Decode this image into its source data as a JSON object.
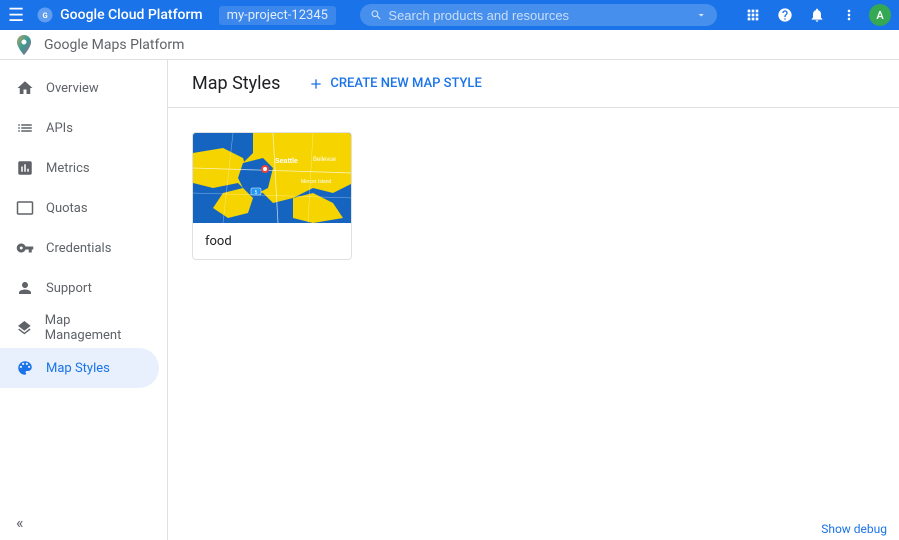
{
  "header": {
    "menu_label": "☰",
    "title": "Google Cloud Platform",
    "project_id": "my-project-12345",
    "search_placeholder": "Search products and resources",
    "icons": {
      "grid": "⊞",
      "help": "?",
      "bell": "🔔",
      "more": "⋮"
    },
    "avatar_initials": "A"
  },
  "brand_bar": {
    "name": "Google Maps Platform"
  },
  "sidebar": {
    "items": [
      {
        "id": "overview",
        "label": "Overview",
        "icon": "home"
      },
      {
        "id": "apis",
        "label": "APIs",
        "icon": "list"
      },
      {
        "id": "metrics",
        "label": "Metrics",
        "icon": "bar_chart"
      },
      {
        "id": "quotas",
        "label": "Quotas",
        "icon": "monitor"
      },
      {
        "id": "credentials",
        "label": "Credentials",
        "icon": "key"
      },
      {
        "id": "support",
        "label": "Support",
        "icon": "person"
      },
      {
        "id": "map-management",
        "label": "Map Management",
        "icon": "layers"
      },
      {
        "id": "map-styles",
        "label": "Map Styles",
        "icon": "palette",
        "active": true
      }
    ],
    "collapse_label": "«"
  },
  "page": {
    "title": "Map Styles",
    "create_button": "CREATE NEW MAP STYLE"
  },
  "map_cards": [
    {
      "id": "food",
      "label": "food",
      "preview_alt": "Seattle area map with blue and yellow colors"
    }
  ],
  "debug_bar": {
    "label": "Show debug"
  },
  "colors": {
    "header_bg": "#1a73e8",
    "active_item": "#1a73e8",
    "active_bg": "#e8f0fe",
    "sidebar_border": "#e0e0e0",
    "map_water": "#1565c0",
    "map_land": "#f5d400",
    "map_road": "#ffffff"
  }
}
